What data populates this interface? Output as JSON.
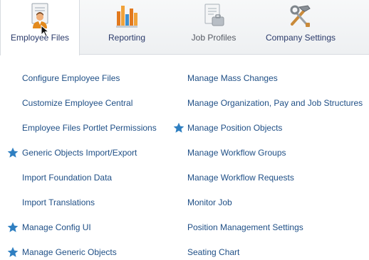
{
  "nav": {
    "tabs": [
      {
        "label": "Employee Files",
        "icon": "employee-files-icon",
        "active": true
      },
      {
        "label": "Reporting",
        "icon": "reporting-chart-icon",
        "active": false
      },
      {
        "label": "Job Profiles",
        "icon": "job-profiles-icon",
        "active": false
      },
      {
        "label": "Company Settings",
        "icon": "company-settings-tools-icon",
        "active": false
      }
    ]
  },
  "links": {
    "left": [
      {
        "label": "Configure Employee Files",
        "starred": false
      },
      {
        "label": "Customize Employee Central",
        "starred": false
      },
      {
        "label": "Employee Files Portlet Permissions",
        "starred": false
      },
      {
        "label": "Generic Objects Import/Export",
        "starred": true
      },
      {
        "label": "Import Foundation Data",
        "starred": false
      },
      {
        "label": "Import Translations",
        "starred": false
      },
      {
        "label": "Manage Config UI",
        "starred": true
      },
      {
        "label": "Manage Generic Objects",
        "starred": true
      }
    ],
    "right": [
      {
        "label": "Manage Mass Changes",
        "starred": false
      },
      {
        "label": "Manage Organization, Pay and Job Structures",
        "starred": false
      },
      {
        "label": "Manage Position Objects",
        "starred": true
      },
      {
        "label": "Manage Workflow Groups",
        "starred": false
      },
      {
        "label": "Manage Workflow Requests",
        "starred": false
      },
      {
        "label": "Monitor Job",
        "starred": false
      },
      {
        "label": "Position Management Settings",
        "starred": false
      },
      {
        "label": "Seating Chart",
        "starred": false
      }
    ]
  },
  "colors": {
    "link": "#1f4f86",
    "star": "#2f7fc1",
    "tab_label": "#2a3a6a"
  }
}
